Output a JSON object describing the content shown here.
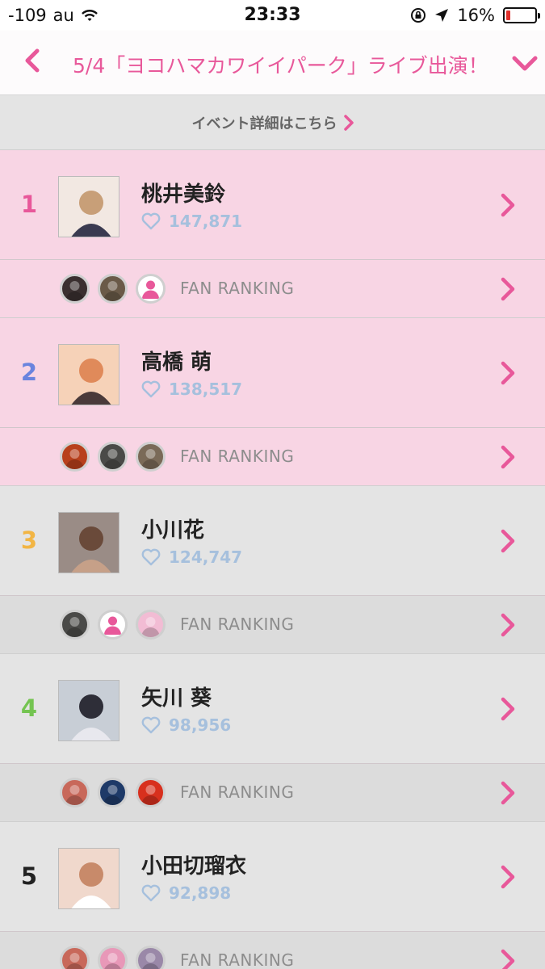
{
  "status_bar": {
    "signal": "-109",
    "carrier": "au",
    "time": "23:33",
    "battery_percent": "16%",
    "battery_level": 0.16,
    "battery_color": "#e0302c"
  },
  "nav": {
    "title": "5/4「ヨコハマカワイイパーク」ライブ出演！",
    "accent_color": "#e8589a"
  },
  "event_link": {
    "label": "イベント詳細はこちら"
  },
  "rankings": [
    {
      "rank": "1",
      "rank_color": "#e8589a",
      "name": "桃井美鈴",
      "likes": "147,871",
      "highlight": true,
      "fan_label": "FAN RANKING",
      "fans": [
        "dog-avatar",
        "group-avatar",
        "default-user-avatar"
      ]
    },
    {
      "rank": "2",
      "rank_color": "#6a84de",
      "name": "高橋 萌",
      "likes": "138,517",
      "highlight": true,
      "fan_label": "FAN RANKING",
      "fans": [
        "red-avatar",
        "dark-avatar",
        "brown-avatar"
      ]
    },
    {
      "rank": "3",
      "rank_color": "#f2b544",
      "name": "小川花",
      "likes": "124,747",
      "highlight": false,
      "fan_label": "FAN RANKING",
      "fans": [
        "dark-avatar",
        "default-user-avatar",
        "pink-logo-avatar"
      ]
    },
    {
      "rank": "4",
      "rank_color": "#74c451",
      "name": "矢川 葵",
      "likes": "98,956",
      "highlight": false,
      "fan_label": "FAN RANKING",
      "fans": [
        "girl-avatar",
        "blue-avatar",
        "red-logo-avatar"
      ]
    },
    {
      "rank": "5",
      "rank_color": "#222222",
      "name": "小田切瑠衣",
      "likes": "92,898",
      "highlight": false,
      "fan_label": "FAN RANKING",
      "fans": [
        "girl-avatar",
        "pink-avatar",
        "purple-avatar"
      ]
    }
  ]
}
